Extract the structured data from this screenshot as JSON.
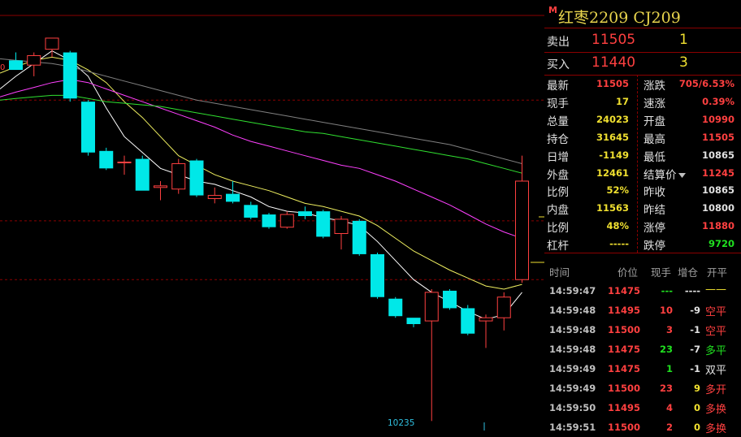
{
  "title": {
    "marker": "M",
    "text": "红枣2209  CJ209"
  },
  "order_book": {
    "ask": {
      "label": "卖出",
      "price": "11505",
      "volume": "1"
    },
    "bid": {
      "label": "买入",
      "price": "11440",
      "volume": "3"
    }
  },
  "stats_left": [
    {
      "label": "最新",
      "value": "11505",
      "color": "red"
    },
    {
      "label": "现手",
      "value": "17",
      "color": "yel"
    },
    {
      "label": "总量",
      "value": "24023",
      "color": "yel"
    },
    {
      "label": "持仓",
      "value": "31645",
      "color": "yel"
    },
    {
      "label": "日增",
      "value": "-1149",
      "color": "yel"
    },
    {
      "label": "外盘",
      "value": "12461",
      "color": "yel"
    },
    {
      "label": "比例",
      "value": "52%",
      "color": "yel"
    },
    {
      "label": "内盘",
      "value": "11563",
      "color": "yel"
    },
    {
      "label": "比例",
      "value": "48%",
      "color": "yel"
    },
    {
      "label": "杠杆",
      "value": "-----",
      "color": "yel"
    }
  ],
  "stats_right": [
    {
      "label": "涨跌",
      "value": "705/6.53%",
      "color": "red"
    },
    {
      "label": "速涨",
      "value": "0.39%",
      "color": "red"
    },
    {
      "label": "开盘",
      "value": "10990",
      "color": "red"
    },
    {
      "label": "最高",
      "value": "11505",
      "color": "red"
    },
    {
      "label": "最低",
      "value": "10865",
      "color": "wht"
    },
    {
      "label": "结算价",
      "value": "11245",
      "color": "red",
      "dropdown": true
    },
    {
      "label": "昨收",
      "value": "10865",
      "color": "wht"
    },
    {
      "label": "昨结",
      "value": "10800",
      "color": "wht"
    },
    {
      "label": "涨停",
      "value": "11880",
      "color": "red"
    },
    {
      "label": "跌停",
      "value": "9720",
      "color": "grn"
    }
  ],
  "ticks_header": {
    "time": "时间",
    "price": "价位",
    "vol": "现手",
    "oi": "增仓",
    "type": "开平"
  },
  "ticks": [
    {
      "time": "14:59:47",
      "price": "11475",
      "vol": "---",
      "vol_color": "grn",
      "oi": "----",
      "oi_color": "wht",
      "type": "——",
      "type_color": "yel"
    },
    {
      "time": "14:59:48",
      "price": "11495",
      "vol": "10",
      "vol_color": "red",
      "oi": "-9",
      "oi_color": "wht",
      "type": "空平",
      "type_color": "red"
    },
    {
      "time": "14:59:48",
      "price": "11500",
      "vol": "3",
      "vol_color": "red",
      "oi": "-1",
      "oi_color": "wht",
      "type": "空平",
      "type_color": "red"
    },
    {
      "time": "14:59:48",
      "price": "11475",
      "vol": "23",
      "vol_color": "grn",
      "oi": "-7",
      "oi_color": "wht",
      "type": "多平",
      "type_color": "grn"
    },
    {
      "time": "14:59:49",
      "price": "11475",
      "vol": "1",
      "vol_color": "grn",
      "oi": "-1",
      "oi_color": "wht",
      "type": "双平",
      "type_color": "wht"
    },
    {
      "time": "14:59:49",
      "price": "11500",
      "vol": "23",
      "vol_color": "red",
      "oi": "9",
      "oi_color": "yel",
      "type": "多开",
      "type_color": "red"
    },
    {
      "time": "14:59:50",
      "price": "11495",
      "vol": "4",
      "vol_color": "red",
      "oi": "0",
      "oi_color": "yel",
      "type": "多换",
      "type_color": "red"
    },
    {
      "time": "14:59:51",
      "price": "11500",
      "vol": "2",
      "vol_color": "red",
      "oi": "0",
      "oi_color": "yel",
      "type": "多换",
      "type_color": "red"
    }
  ],
  "chart_data": {
    "type": "candlestick",
    "low_label": "10235",
    "left_label": "0",
    "ylim": [
      10200,
      11560
    ],
    "candles": [
      {
        "o": 11370,
        "h": 11395,
        "l": 11340,
        "c": 11340
      },
      {
        "o": 11355,
        "h": 11395,
        "l": 11320,
        "c": 11385
      },
      {
        "o": 11405,
        "h": 11440,
        "l": 11380,
        "c": 11440
      },
      {
        "o": 11395,
        "h": 11400,
        "l": 11240,
        "c": 11250
      },
      {
        "o": 11240,
        "h": 11245,
        "l": 11070,
        "c": 11080
      },
      {
        "o": 11085,
        "h": 11095,
        "l": 11025,
        "c": 11030
      },
      {
        "o": 11050,
        "h": 11070,
        "l": 11010,
        "c": 11050
      },
      {
        "o": 11060,
        "h": 11070,
        "l": 10960,
        "c": 10960
      },
      {
        "o": 10970,
        "h": 10990,
        "l": 10930,
        "c": 10975
      },
      {
        "o": 10965,
        "h": 11060,
        "l": 10950,
        "c": 11045
      },
      {
        "o": 11055,
        "h": 11060,
        "l": 10940,
        "c": 10945
      },
      {
        "o": 10935,
        "h": 10970,
        "l": 10920,
        "c": 10945
      },
      {
        "o": 10950,
        "h": 10990,
        "l": 10920,
        "c": 10925
      },
      {
        "o": 10915,
        "h": 10925,
        "l": 10870,
        "c": 10875
      },
      {
        "o": 10885,
        "h": 10890,
        "l": 10840,
        "c": 10845
      },
      {
        "o": 10845,
        "h": 10895,
        "l": 10840,
        "c": 10885
      },
      {
        "o": 10895,
        "h": 10910,
        "l": 10870,
        "c": 10880
      },
      {
        "o": 10895,
        "h": 10900,
        "l": 10810,
        "c": 10815
      },
      {
        "o": 10825,
        "h": 10880,
        "l": 10775,
        "c": 10870
      },
      {
        "o": 10865,
        "h": 10870,
        "l": 10755,
        "c": 10760
      },
      {
        "o": 10760,
        "h": 10765,
        "l": 10620,
        "c": 10625
      },
      {
        "o": 10620,
        "h": 10625,
        "l": 10560,
        "c": 10565
      },
      {
        "o": 10560,
        "h": 10560,
        "l": 10530,
        "c": 10540
      },
      {
        "o": 10550,
        "h": 10650,
        "l": 10235,
        "c": 10640
      },
      {
        "o": 10645,
        "h": 10650,
        "l": 10585,
        "c": 10590
      },
      {
        "o": 10590,
        "h": 10600,
        "l": 10505,
        "c": 10510
      },
      {
        "o": 10550,
        "h": 10570,
        "l": 10465,
        "c": 10560
      },
      {
        "o": 10560,
        "h": 10640,
        "l": 10520,
        "c": 10625
      },
      {
        "o": 10680,
        "h": 11070,
        "l": 10670,
        "c": 10990
      }
    ],
    "ma_lines": [
      {
        "name": "MA5",
        "color": "#ffffff",
        "values": [
          11320,
          11360,
          11400,
          11370,
          11320,
          11220,
          11130,
          11080,
          11030,
          11010,
          10990,
          10980,
          10960,
          10940,
          10910,
          10895,
          10890,
          10875,
          10865,
          10850,
          10800,
          10740,
          10680,
          10640,
          10610,
          10580,
          10555,
          10570,
          10640
        ]
      },
      {
        "name": "MA10",
        "color": "#f0f060",
        "values": [
          11350,
          11370,
          11380,
          11370,
          11340,
          11300,
          11240,
          11190,
          11130,
          11070,
          11040,
          11010,
          10990,
          10975,
          10960,
          10940,
          10920,
          10910,
          10895,
          10880,
          10850,
          10810,
          10770,
          10740,
          10710,
          10685,
          10660,
          10650,
          10665
        ]
      },
      {
        "name": "MA20",
        "color": "#ff40ff",
        "values": [
          11270,
          11285,
          11300,
          11310,
          11300,
          11280,
          11260,
          11240,
          11220,
          11200,
          11180,
          11160,
          11135,
          11115,
          11100,
          11085,
          11070,
          11055,
          11040,
          11030,
          11010,
          10990,
          10965,
          10940,
          10915,
          10885,
          10855,
          10830,
          10810
        ]
      },
      {
        "name": "MA40",
        "color": "#808080",
        "values": [
          11370,
          11365,
          11360,
          11350,
          11335,
          11320,
          11305,
          11290,
          11275,
          11260,
          11245,
          11235,
          11225,
          11215,
          11205,
          11195,
          11185,
          11175,
          11165,
          11155,
          11145,
          11135,
          11125,
          11115,
          11105,
          11090,
          11075,
          11060,
          11045
        ]
      },
      {
        "name": "MA60",
        "color": "#30e030",
        "values": [
          11250,
          11255,
          11260,
          11260,
          11250,
          11240,
          11235,
          11230,
          11225,
          11215,
          11205,
          11195,
          11185,
          11175,
          11165,
          11155,
          11145,
          11140,
          11130,
          11120,
          11110,
          11100,
          11090,
          11080,
          11070,
          11060,
          11045,
          11030,
          11015
        ]
      }
    ]
  }
}
